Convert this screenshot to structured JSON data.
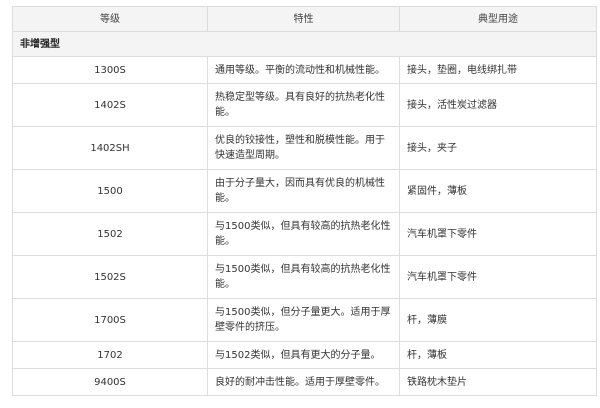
{
  "table": {
    "headers": [
      "等级",
      "特性",
      "典型用途"
    ],
    "section_title": "非增强型",
    "rows": [
      {
        "grade": "1300S",
        "property": "通用等级。平衡的流动性和机械性能。",
        "use": "接头，垫圈，电线绑扎带"
      },
      {
        "grade": "1402S",
        "property": "热稳定型等级。具有良好的抗热老化性能。",
        "use": "接头，活性炭过滤器"
      },
      {
        "grade": "1402SH",
        "property": "优良的铰接性，塑性和脱模性能。用于快速造型周期。",
        "use": "接头，夹子"
      },
      {
        "grade": "1500",
        "property": "由于分子量大，因而具有优良的机械性能。",
        "use": "紧固件，薄板"
      },
      {
        "grade": "1502",
        "property": "与1500类似，但具有较高的抗热老化性能。",
        "use": "汽车机罩下零件"
      },
      {
        "grade": "1502S",
        "property": "与1500类似，但具有较高的抗热老化性能。",
        "use": "汽车机罩下零件"
      },
      {
        "grade": "1700S",
        "property": "与1500类似，但分子量更大。适用于厚壁零件的挤压。",
        "use": "杆，薄膜"
      },
      {
        "grade": "1702",
        "property": "与1502类似，但具有更大的分子量。",
        "use": "杆，薄板"
      },
      {
        "grade": "9400S",
        "property": "良好的耐冲击性能。适用于厚壁零件。",
        "use": "铁路枕木垫片"
      }
    ]
  }
}
